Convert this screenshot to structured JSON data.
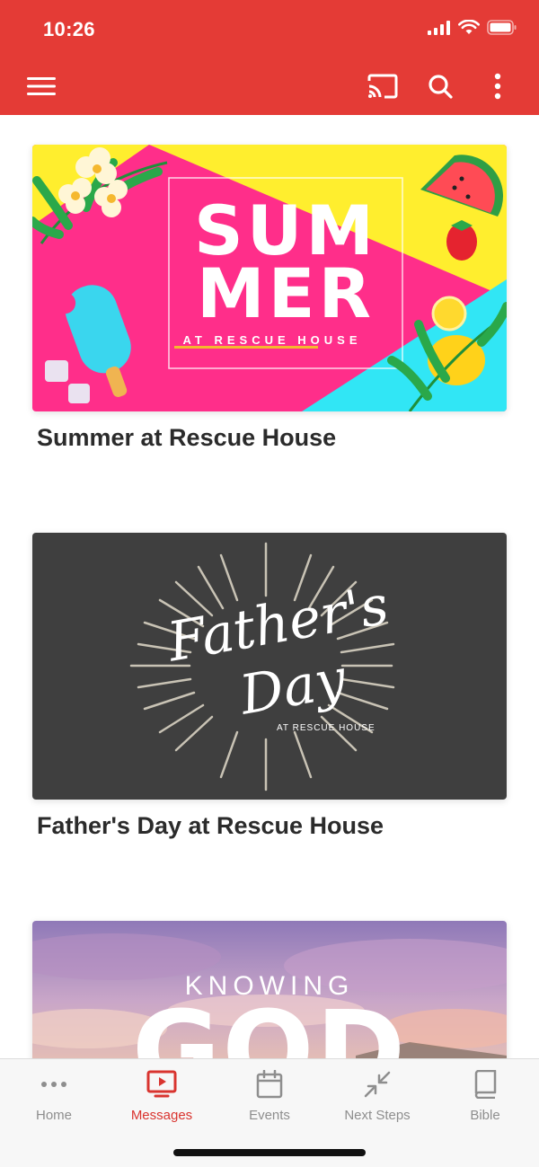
{
  "status_bar": {
    "time": "10:26"
  },
  "header": {
    "menu_icon": "hamburger-menu-icon",
    "cast_icon": "cast-icon",
    "search_icon": "search-icon",
    "more_icon": "more-vertical-icon",
    "color": "#e43b36"
  },
  "messages": [
    {
      "title": "Summer at Rescue House",
      "art": {
        "line1": "SUM",
        "line2": "MER",
        "subtitle": "AT RESCUE HOUSE"
      }
    },
    {
      "title": "Father's Day at Rescue House",
      "art": {
        "script1": "Father's",
        "script2": "Day",
        "subtitle": "AT RESCUE HOUSE"
      }
    },
    {
      "title": "",
      "art": {
        "line1": "KNOWING",
        "line2": "GOD"
      }
    }
  ],
  "tabbar": {
    "tabs": [
      {
        "label": "Home",
        "icon": "more-horizontal-icon",
        "active": false
      },
      {
        "label": "Messages",
        "icon": "tv-play-icon",
        "active": true
      },
      {
        "label": "Events",
        "icon": "calendar-icon",
        "active": false
      },
      {
        "label": "Next Steps",
        "icon": "arrows-in-icon",
        "active": false
      },
      {
        "label": "Bible",
        "icon": "book-icon",
        "active": false
      }
    ],
    "active_color": "#d9342f",
    "inactive_color": "#8e8e8e"
  }
}
